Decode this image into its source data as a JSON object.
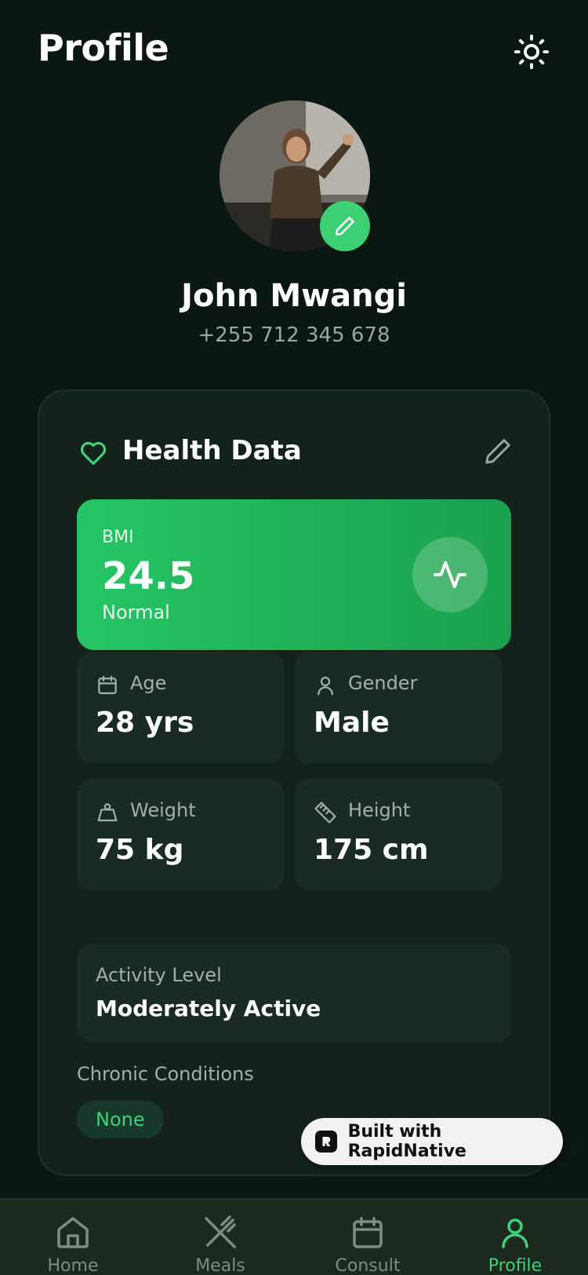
{
  "header": {
    "title": "Profile",
    "theme_icon": "sun-icon"
  },
  "profile": {
    "name": "John Mwangi",
    "phone": "+255 712 345 678",
    "edit_icon": "pencil-icon"
  },
  "health": {
    "title": "Health Data",
    "bmi": {
      "label": "BMI",
      "value": "24.5",
      "status": "Normal",
      "icon": "activity-icon"
    },
    "stats": [
      {
        "label": "Age",
        "value": "28 yrs",
        "icon": "calendar-icon"
      },
      {
        "label": "Gender",
        "value": "Male",
        "icon": "user-icon"
      },
      {
        "label": "Weight",
        "value": "75 kg",
        "icon": "weight-icon"
      },
      {
        "label": "Height",
        "value": "175 cm",
        "icon": "ruler-icon"
      }
    ],
    "activity": {
      "label": "Activity Level",
      "value": "Moderately Active"
    },
    "conditions": {
      "label": "Chronic Conditions",
      "items": [
        "None"
      ]
    }
  },
  "badge": {
    "text": "Built with RapidNative"
  },
  "nav": {
    "items": [
      {
        "label": "Home",
        "icon": "home-icon",
        "active": false
      },
      {
        "label": "Meals",
        "icon": "utensils-icon",
        "active": false
      },
      {
        "label": "Consult",
        "icon": "calendar-icon",
        "active": false
      },
      {
        "label": "Profile",
        "icon": "user-icon",
        "active": true
      }
    ]
  },
  "colors": {
    "background": "#0b1712",
    "card": "#13231c",
    "tile": "#1a2b23",
    "accent": "#3fd27a",
    "bmi_gradient_start": "#25c564",
    "bmi_gradient_end": "#1ba14e",
    "muted_text": "#a3b0a9"
  }
}
